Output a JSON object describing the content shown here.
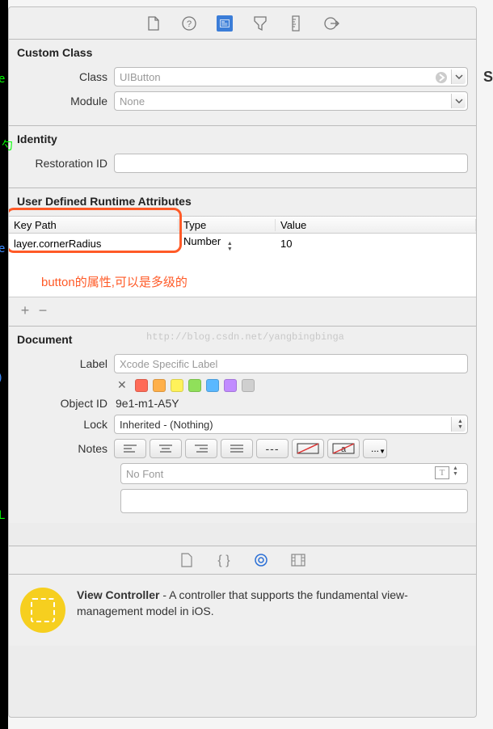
{
  "toolbar": {
    "icons": [
      "file-icon",
      "help-icon",
      "identity-icon",
      "attributes-icon",
      "size-icon",
      "connections-icon"
    ]
  },
  "customClass": {
    "title": "Custom Class",
    "classLabel": "Class",
    "classValue": "UIButton",
    "moduleLabel": "Module",
    "moduleValue": "None"
  },
  "identity": {
    "title": "Identity",
    "restorationLabel": "Restoration ID",
    "restorationValue": ""
  },
  "runtimeAttrs": {
    "title": "User Defined Runtime Attributes",
    "headers": {
      "keypath": "Key Path",
      "type": "Type",
      "value": "Value"
    },
    "row": {
      "keypath": "layer.cornerRadius",
      "type": "Number",
      "value": "10"
    },
    "annotation": "button的属性,可以是多级的"
  },
  "document": {
    "title": "Document",
    "watermark": "http://blog.csdn.net/yangbingbinga",
    "labelLabel": "Label",
    "labelPlaceholder": "Xcode Specific Label",
    "swatches": [
      "#ff6b57",
      "#ffb04a",
      "#fff25a",
      "#90e05a",
      "#5ab8ff",
      "#c18bff",
      "#cfcfcf"
    ],
    "objectIdLabel": "Object ID",
    "objectIdValue": "9e1-m1-A5Y",
    "lockLabel": "Lock",
    "lockValue": "Inherited - (Nothing)",
    "notesLabel": "Notes",
    "noFont": "No Font"
  },
  "bottomNav": {
    "icons": [
      "file-icon",
      "braces-icon",
      "target-icon",
      "film-icon"
    ]
  },
  "quickHelp": {
    "title": "View Controller",
    "desc": " - A controller that supports the fundamental view-management model in iOS."
  },
  "edgeRight": "S"
}
